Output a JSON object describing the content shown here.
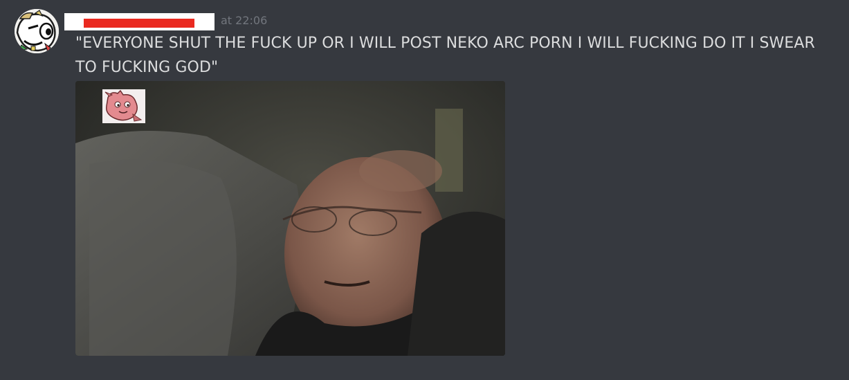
{
  "message": {
    "author_name": "",
    "timestamp": "at 22:06",
    "content": "\"EVERYONE SHUT THE FUCK UP OR I WILL POST NEKO ARC PORN I WILL FUCKING DO IT I SWEAR TO FUCKING GOD\"",
    "avatar_icon": "cartoon-face-avatar-icon",
    "attachment": {
      "type": "video-still",
      "overlay_icon": "pink-creature-sticker-icon"
    }
  },
  "colors": {
    "background": "#36393f",
    "text": "#dcddde",
    "timestamp": "#72767d",
    "redaction_box": "#ffffff",
    "redaction_bar": "#ea2a20"
  }
}
